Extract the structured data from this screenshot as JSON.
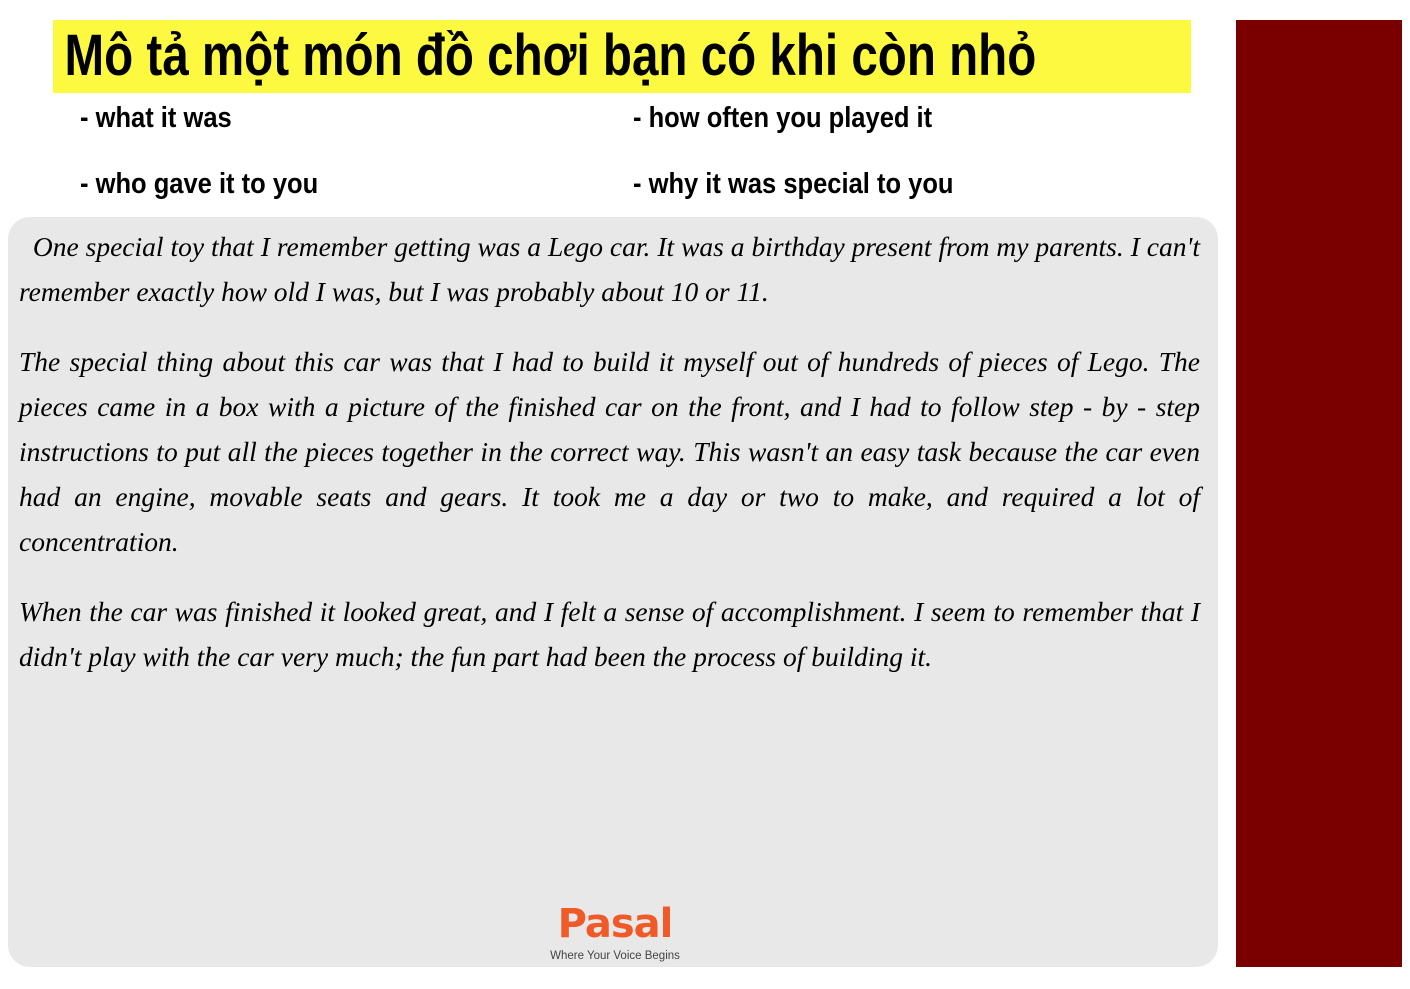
{
  "title": "Mô tả một món đồ chơi bạn có khi còn nhỏ",
  "prompts": [
    "- what it was",
    "- how often you played it",
    "- who gave it to you",
    "- why it was special to you"
  ],
  "essay": {
    "paragraphs": [
      "  One special toy that I remember getting was a Lego car. It was a birthday present from my parents. I can't remember exactly how old I was, but I was probably about 10 or 11.",
      "The special thing about this car was that I had to build it myself out of hundreds of pieces of Lego. The pieces came in a box with a picture of the finished car on the front, and I had to follow step - by - step instructions to put all the pieces together in the correct way. This wasn't an easy task because the car even had an engine, movable seats and gears. It took me a day or two to make, and required a lot of concentration.",
      "When the car was finished it looked great, and I felt a sense of accomplishment. I seem to remember that I didn't play with the car very much; the fun part had been the process of building it."
    ]
  },
  "logo": {
    "name": "Pasal",
    "tagline": "Where Your Voice Begins"
  },
  "colors": {
    "title_bg": "#fdf940",
    "sidebar": "#7a0000",
    "card": "#e8e8e8",
    "brand": "#f05a28"
  }
}
